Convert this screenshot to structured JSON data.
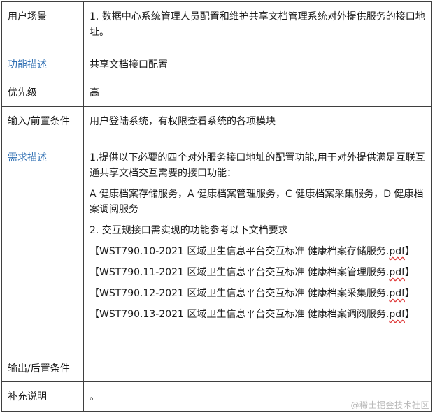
{
  "rows": [
    {
      "label": "用户场景",
      "content": "1. 数据中心系统管理人员配置和维护共享文档管理系统对外提供服务的接口地址。"
    },
    {
      "label": "功能描述",
      "content": "共享文档接口配置"
    },
    {
      "label": "优先级",
      "content": "高"
    },
    {
      "label": "输入/前置条件",
      "content": "用户登陆系统，有权限查看系统的各项模块"
    },
    {
      "label": "需求描述",
      "paragraphs": [
        "1.提供以下必要的四个对外服务接口地址的配置功能,用于对外提供满足互联互通共享文档交互需要的接口功能：",
        "A 健康档案存储服务，A 健康档案管理服务，C 健康档案采集服务，D 健康档案调阅服务",
        "2. 交互规接口需实现的功能参考以下文档要求"
      ],
      "references": [
        {
          "prefix": "【WST790.10-2021 区域卫生信息平台交互标准 健康档案存储服务.",
          "file": "pdf",
          "suffix": "】"
        },
        {
          "prefix": "【WST790.11-2021 区域卫生信息平台交互标准 健康档案管理服务.",
          "file": "pdf",
          "suffix": "】"
        },
        {
          "prefix": "【WST790.12-2021 区域卫生信息平台交互标准 健康档案采集服务.",
          "file": "pdf",
          "suffix": "】"
        },
        {
          "prefix": "【WST790.13-2021 区域卫生信息平台交互标准 健康档案调阅服务.",
          "file": "pdf",
          "suffix": "】"
        }
      ]
    },
    {
      "label": "输出/后置条件",
      "content": ""
    },
    {
      "label": "补充说明",
      "content": "。"
    }
  ],
  "watermark": "@稀土掘金技术社区",
  "colors": {
    "label_link": "#2f6fb3",
    "border": "#3f3f3f",
    "spell_underline": "#e04040"
  }
}
